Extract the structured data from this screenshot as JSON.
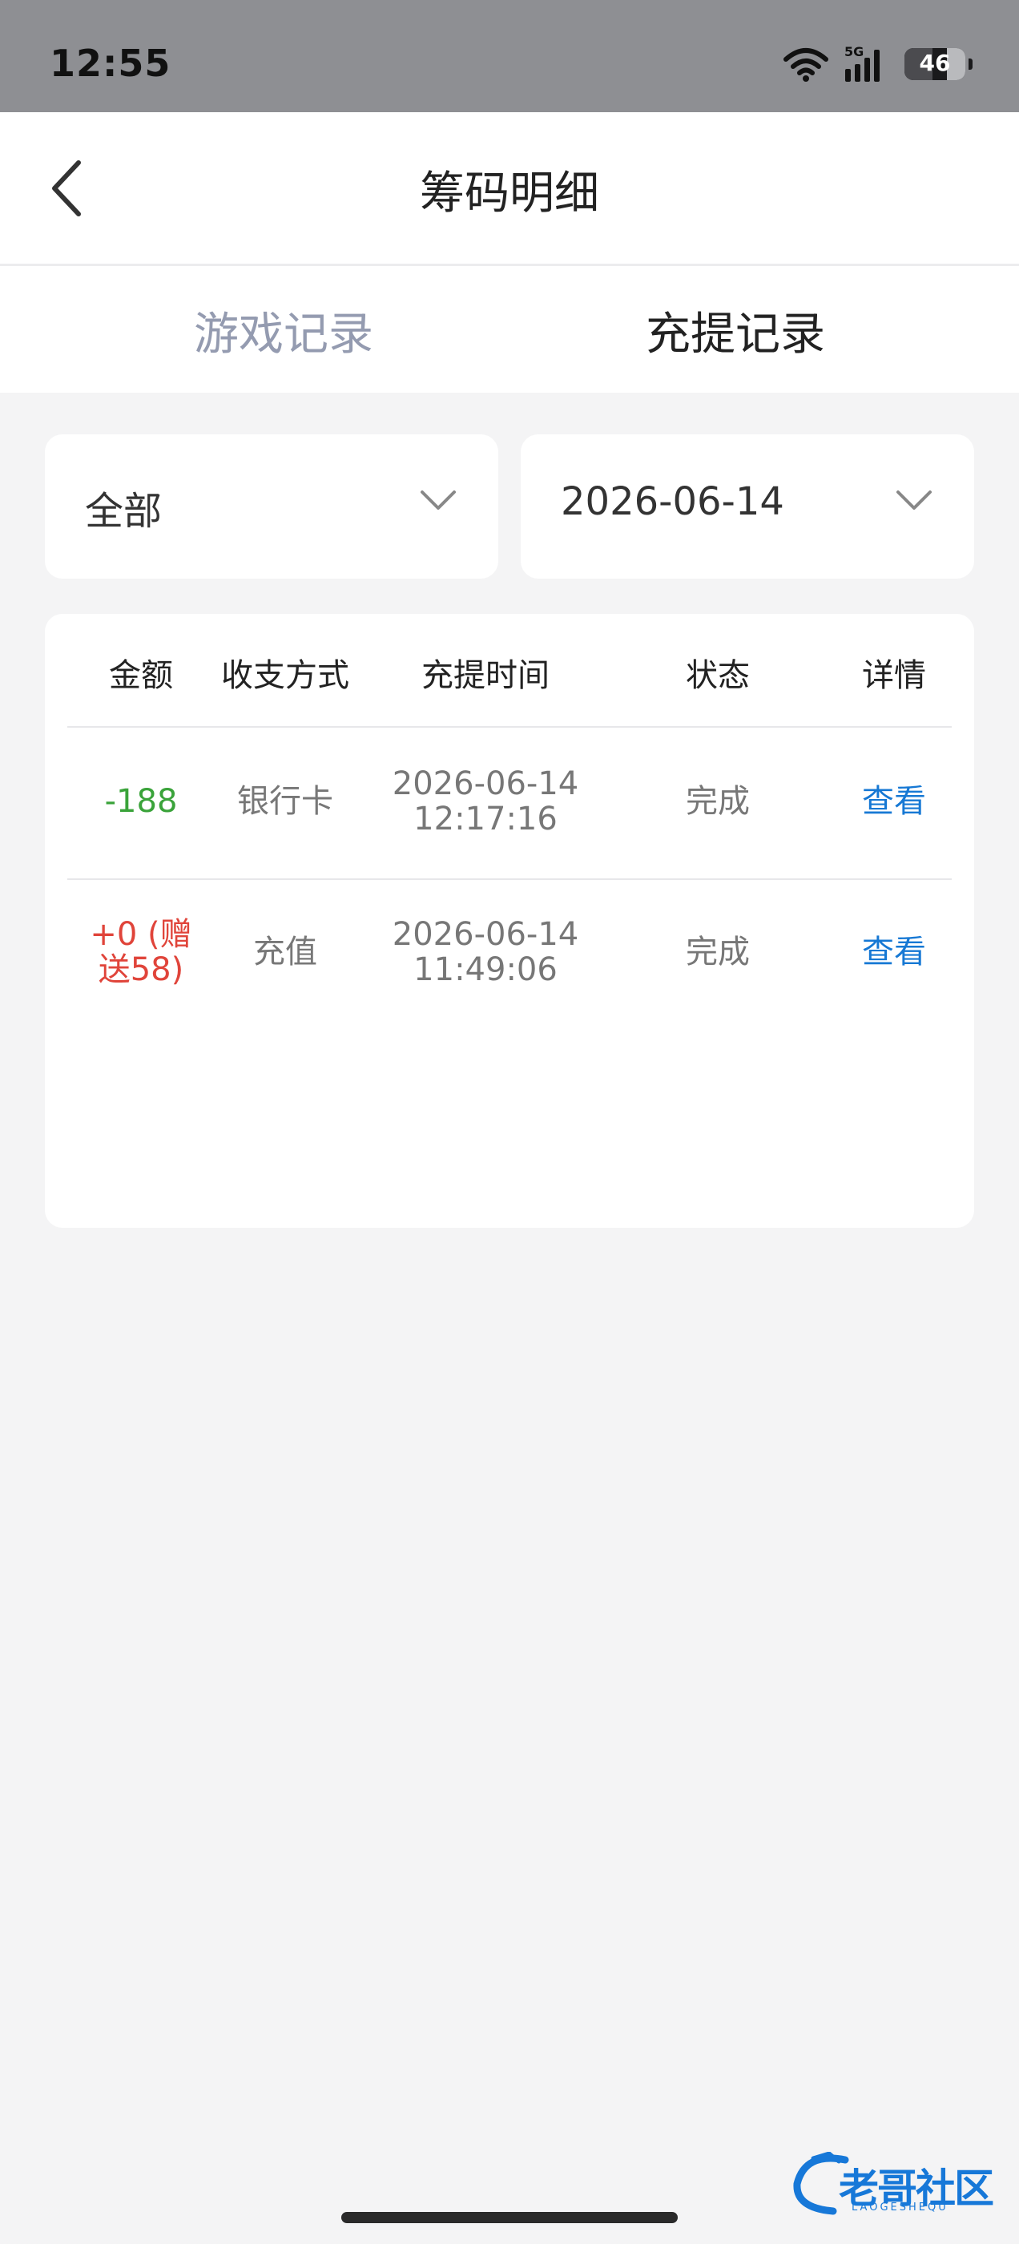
{
  "status_bar": {
    "time": "12:55",
    "network": "5G",
    "battery_level": 46,
    "battery_label": "46"
  },
  "nav": {
    "title": "筹码明细",
    "back_icon": "chevron-left-icon"
  },
  "tabs": [
    {
      "label": "游戏记录",
      "active": false
    },
    {
      "label": "充提记录",
      "active": true
    }
  ],
  "filters": {
    "type": "全部",
    "date": "2026-06-14"
  },
  "table": {
    "headers": [
      "金额",
      "收支方式",
      "充提时间",
      "状态",
      "详情"
    ],
    "rows": [
      {
        "amount": "-188",
        "method": "银行卡",
        "date": "2026-06-14",
        "time": "12:17:16",
        "status": "完成",
        "detail": "查看"
      },
      {
        "amount_line1": "+0 (赠",
        "amount_line2": "送58)",
        "method": "充值",
        "date": "2026-06-14",
        "time": "11:49:06",
        "status": "完成",
        "detail": "查看"
      }
    ]
  },
  "colors": {
    "negative": "#3aa33a",
    "positive": "#e0443a",
    "link": "#1678d4",
    "inactive_tab": "#949bb0"
  },
  "watermark": {
    "text": "老哥社区",
    "subtext": "LAOGESHEQU"
  }
}
